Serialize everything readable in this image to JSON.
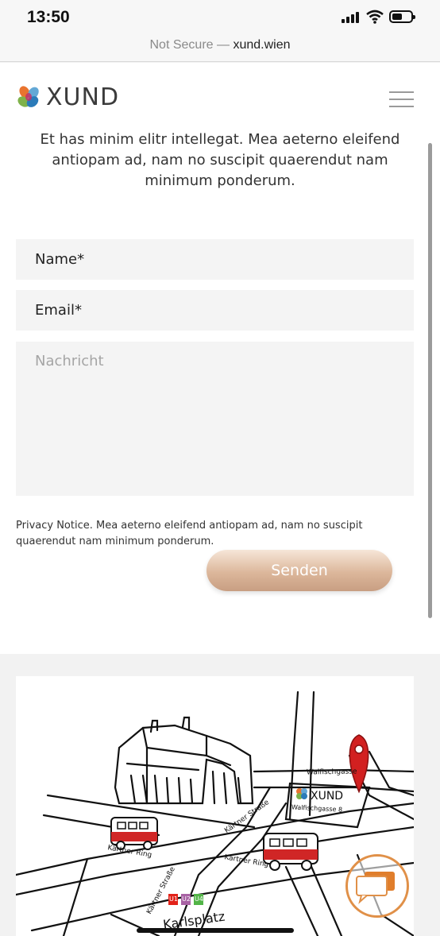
{
  "status_bar": {
    "time": "13:50"
  },
  "browser": {
    "security_label": "Not Secure",
    "separator": " — ",
    "domain": "xund.wien"
  },
  "header": {
    "brand": "XUND"
  },
  "intro_text": "Et has minim elitr intellegat. Mea aeterno eleifend antiopam ad, nam no suscipit quaerendut nam minimum ponderum.",
  "form": {
    "name_placeholder": "Name*",
    "email_placeholder": "Email*",
    "message_placeholder": "Nachricht",
    "privacy_notice": "Privacy Notice. Mea aeterno eleifend antiopam ad, nam no suscipit quaerendut nam minimum ponderum.",
    "submit_label": "Senden"
  },
  "map": {
    "streets": [
      "Walfischgasse",
      "Kärtner Straße",
      "Kärtner Ring",
      "Kärtner Straße"
    ],
    "brand": "XUND",
    "address": "Walfischgasse 8",
    "station": "Karlsplatz",
    "lines": [
      "U1",
      "U2",
      "U4"
    ],
    "line_colors": [
      "#e2231a",
      "#a862a4",
      "#52b447"
    ]
  },
  "colors": {
    "accent": "#dcb79b",
    "chat_ring": "#e09048",
    "pin": "#d22020"
  }
}
